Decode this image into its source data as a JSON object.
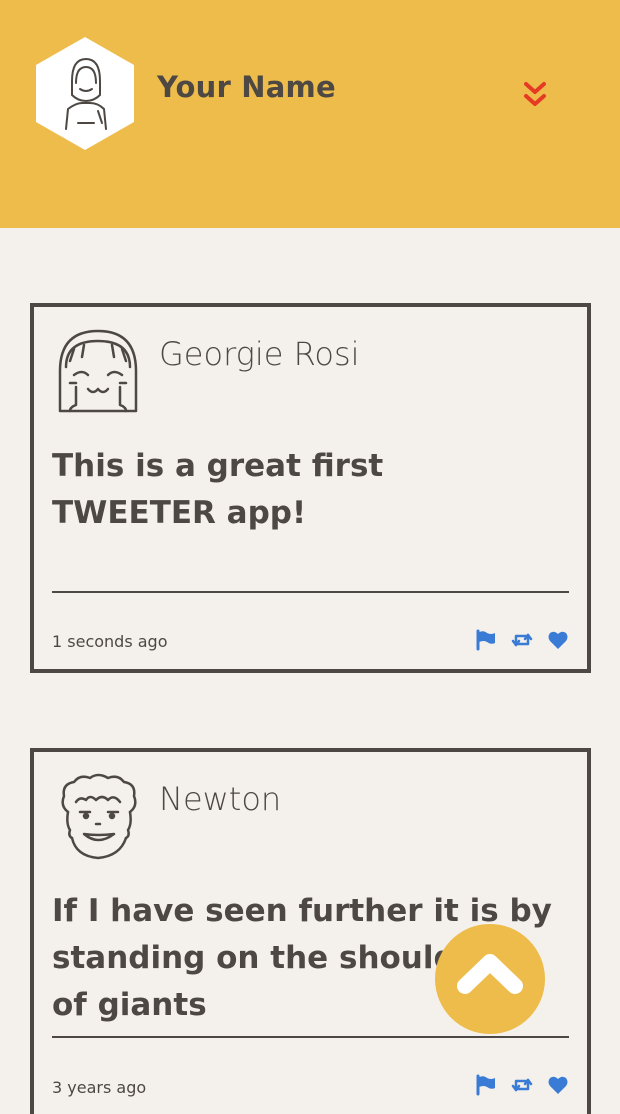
{
  "profile": {
    "name": "Your Name",
    "avatar_icon": "user-avatar-icon",
    "toggle_icon": "double-chevron-down-icon"
  },
  "colors": {
    "header_bg": "#eebc4a",
    "page_bg": "#f4f1ed",
    "text": "#4d4843",
    "accent_red": "#e53b25",
    "action_blue": "#3a7bd5"
  },
  "tweets": [
    {
      "author": "Georgie Rosi",
      "text": "This is a great first TWEETER app!",
      "time": "1 seconds ago",
      "avatar_icon": "girl-avatar-icon"
    },
    {
      "author": "Newton",
      "text": "If I have seen further it is by standing on the shoulders of giants",
      "time": "3 years ago",
      "avatar_icon": "curly-hair-avatar-icon"
    }
  ],
  "actions": [
    "flag-icon",
    "retweet-icon",
    "heart-icon"
  ],
  "scroll_button": {
    "icon": "chevron-up-icon"
  }
}
